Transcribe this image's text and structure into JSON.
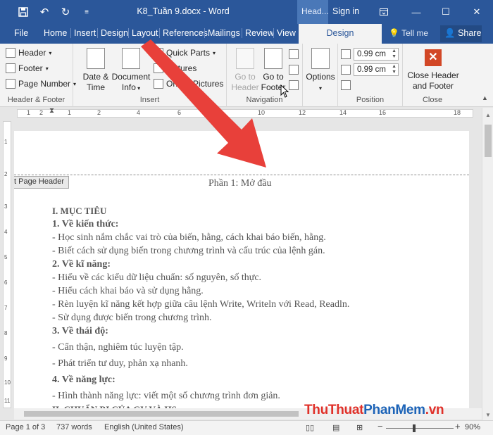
{
  "titlebar": {
    "quick_access": [
      "save-icon",
      "undo-icon",
      "redo-icon",
      "customize-icon"
    ],
    "document_title": "K8_Tuần 9.docx - Word",
    "context_tab": "Header & Footer Tools",
    "context_tab_short": "Head...",
    "sign_in": "Sign in",
    "window_buttons": [
      "ribbon-display-icon",
      "minimize-icon",
      "maximize-icon",
      "close-icon"
    ]
  },
  "tabs": {
    "items": [
      "File",
      "Home",
      "Insert",
      "Design",
      "Layout",
      "References",
      "Mailings",
      "Review",
      "View"
    ],
    "active": "Design",
    "tell_me": "Tell me",
    "share": "Share"
  },
  "ribbon": {
    "header_footer": {
      "label": "Header & Footer",
      "header": "Header",
      "footer": "Footer",
      "page_number": "Page Number"
    },
    "insert": {
      "label": "Insert",
      "date_time": [
        "Date &",
        "Time"
      ],
      "document_info": [
        "Document",
        "Info"
      ],
      "quick_parts": "Quick Parts",
      "pictures": "Pictures",
      "online_pictures": "Online Pictures"
    },
    "navigation": {
      "label": "Navigation",
      "go_to_header": [
        "Go to",
        "Header"
      ],
      "go_to_footer": [
        "Go to",
        "Footer"
      ]
    },
    "options": {
      "label": "Options"
    },
    "position": {
      "label": "Position",
      "header_from_top": "0.99 cm",
      "footer_from_bottom": "0.99 cm"
    },
    "close": {
      "label": "Close",
      "button": [
        "Close Header",
        "and Footer"
      ]
    }
  },
  "ruler": {
    "numbers": [
      "1",
      "2",
      "1",
      "2",
      "4",
      "6",
      "8",
      "10",
      "12",
      "14",
      "16",
      "18"
    ],
    "vertical_numbers": [
      "1",
      "2",
      "3",
      "4",
      "5",
      "6",
      "7",
      "8",
      "9",
      "10",
      "11"
    ]
  },
  "document": {
    "header_tag": "First Page Header",
    "header_text": "Phần 1: Mở đầu",
    "lines": [
      {
        "text": "I. MỤC TIÊU",
        "style": "h1"
      },
      {
        "text": "1. Về kiến thức:",
        "style": "h"
      },
      {
        "text": "- Học sinh nắm chắc vai trò của biến, hằng, cách khai báo biến, hằng.",
        "style": "n"
      },
      {
        "text": "- Biết cách sử dụng biến trong chương trình và cấu trúc của lệnh gán.",
        "style": "n"
      },
      {
        "text": "2. Về kĩ năng:",
        "style": "h"
      },
      {
        "text": "- Hiểu về các kiểu dữ liệu chuẩn: số nguyên, số thực.",
        "style": "n"
      },
      {
        "text": "- Hiểu cách khai báo và sử dụng hằng.",
        "style": "n"
      },
      {
        "text": "- Rèn luyện kĩ năng kết hợp giữa câu lệnh Write, Writeln với Read, Readln.",
        "style": "n"
      },
      {
        "text": "- Sử dụng được biến trong chương trình.",
        "style": "n"
      },
      {
        "text": "3. Về thái độ:",
        "style": "h"
      },
      {
        "text": "- Cẩn thận, nghiêm túc luyện tập.",
        "style": "n gap"
      },
      {
        "text": "- Phát triển tư duy, phản xạ nhanh.",
        "style": "n gap"
      },
      {
        "text": "4. Về năng lực:",
        "style": "h gap"
      },
      {
        "text": "- Hình thành năng lực: viết một số chương trình đơn giản.",
        "style": "n gap"
      },
      {
        "text": "II. CHUẨN BỊ CỦA GV VÀ HS",
        "style": "h1"
      }
    ]
  },
  "status": {
    "page": "Page 1 of 3",
    "words": "737 words",
    "language": "English (United States)",
    "zoom": "90%",
    "zoom_minus": "−",
    "zoom_plus": "+"
  },
  "watermark": {
    "part1": "ThuThuat",
    "part2": "PhanMem",
    "part3": ".vn"
  },
  "colors": {
    "word_blue": "#2b579a",
    "arrow_red": "#e8403a",
    "close_red": "#d24726",
    "watermark_red": "#e0312a",
    "watermark_blue": "#1d64b8"
  }
}
